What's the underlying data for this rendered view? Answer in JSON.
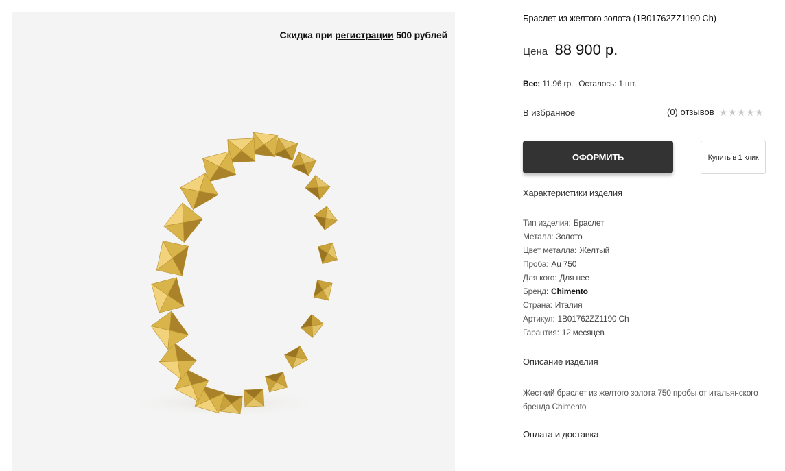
{
  "promo": {
    "prefix": "Скидка при ",
    "link": "регистрации",
    "suffix": " 500 рублей"
  },
  "product": {
    "title": "Браслет из желтого золота (1B01762ZZ1190 Ch)",
    "price_label": "Цена",
    "price_value": "88 900 р.",
    "weight_label": "Вес:",
    "weight_value": "11.96 гр.",
    "stock_text": "Осталось: 1 шт.",
    "favorites_label": "В избранное",
    "reviews_text": "(0) отзывов",
    "rating": 0,
    "rating_max": 5
  },
  "buttons": {
    "order_label": "ОФОРМИТЬ",
    "one_click_label": "Купить в 1 клик"
  },
  "specs": {
    "title": "Характеристики изделия",
    "rows": [
      {
        "key": "Тип изделия:",
        "value": "Браслет"
      },
      {
        "key": "Металл:",
        "value": "Золото"
      },
      {
        "key": "Цвет металла:",
        "value": "Желтый"
      },
      {
        "key": "Проба:",
        "value": "Au 750"
      },
      {
        "key": "Для кого:",
        "value": "Для нее"
      },
      {
        "key": "Бренд:",
        "value": "Chimento"
      },
      {
        "key": "Страна:",
        "value": "Италия"
      },
      {
        "key": "Артикул:",
        "value": "1B01762ZZ1190 Ch"
      },
      {
        "key": "Гарантия:",
        "value": "12 месяцев"
      }
    ]
  },
  "description": {
    "title": "Описание изделия",
    "text": "Жесткий браслет из желтого золота 750 пробы от итальянского бренда Chimento"
  },
  "delivery_link": "Оплата и доставка",
  "colors": {
    "button_dark": "#333333",
    "star_empty": "#c7c7c7",
    "image_bg": "#f4f4f4",
    "gold": "#d9b44a"
  }
}
